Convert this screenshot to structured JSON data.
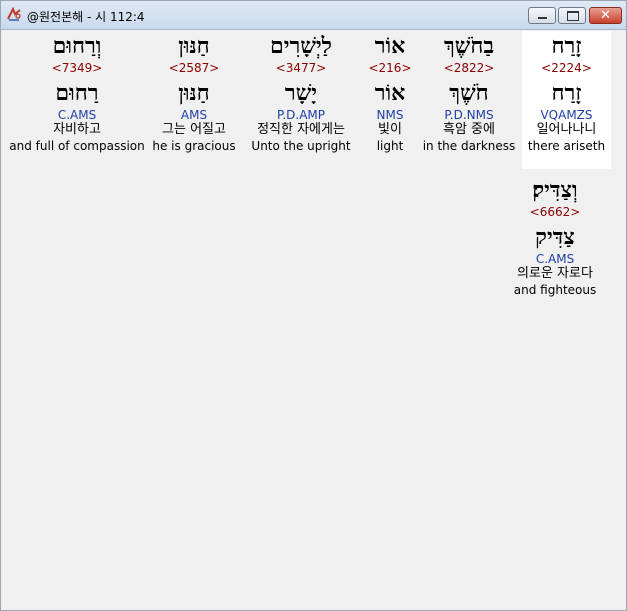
{
  "window": {
    "title": "@원전본해 - 시 112:4",
    "close_glyph": "✕"
  },
  "words": [
    {
      "hebrew": "זָרַח",
      "strongs": "<2224>",
      "lemma": "זָרַח",
      "parsing": "VQAMZS",
      "korean": "일어나나니",
      "english": "there ariseth"
    },
    {
      "hebrew": "בַחֹשֶׁךְ",
      "strongs": "<2822>",
      "lemma": "חֹשֶׁךְ",
      "parsing": "P.D.NMS",
      "korean": "흑암 중에",
      "english": "in the darkness"
    },
    {
      "hebrew": "אוֹר",
      "strongs": "<216>",
      "lemma": "אוֹר",
      "parsing": "NMS",
      "korean": "빛이",
      "english": "light"
    },
    {
      "hebrew": "לַיְשָׁרִים",
      "strongs": "<3477>",
      "lemma": "יָשָׁר",
      "parsing": "P.D.AMP",
      "korean": "정직한 자에게는",
      "english": "Unto the upright"
    },
    {
      "hebrew": "חַנּוּן",
      "strongs": "<2587>",
      "lemma": "חַנּוּן",
      "parsing": "AMS",
      "korean": "그는 어질고",
      "english": "he is gracious"
    },
    {
      "hebrew": "וְרַחוּם",
      "strongs": "<7349>",
      "lemma": "רַחוּם",
      "parsing": "C.AMS",
      "korean": "자비하고",
      "english": "and full of compassion"
    },
    {
      "hebrew": "וְצַדִּיק׃",
      "strongs": "<6662>",
      "lemma": "צַדִּיק",
      "parsing": "C.AMS",
      "korean": "의로운 자로다",
      "english": "and fighteous"
    }
  ]
}
